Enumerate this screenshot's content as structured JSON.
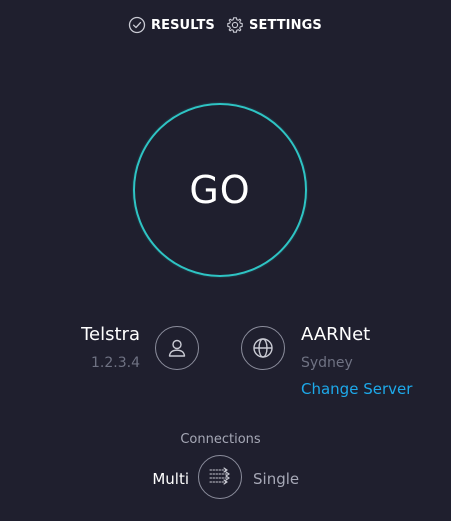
{
  "nav": {
    "results_label": "RESULTS",
    "settings_label": "SETTINGS"
  },
  "go_button": {
    "label": "GO"
  },
  "isp": {
    "name": "Telstra",
    "ip": "1.2.3.4"
  },
  "server": {
    "name": "AARNet",
    "location": "Sydney",
    "change_label": "Change Server"
  },
  "connections": {
    "title": "Connections",
    "multi_label": "Multi",
    "single_label": "Single",
    "selected": "Multi"
  },
  "colors": {
    "background": "#1f1f2e",
    "go_ring": "#2ec4c4",
    "link": "#1da9ea",
    "muted_text": "#6f7283",
    "icon_stroke": "#8b8d9c"
  },
  "icons": {
    "results": "check-circle-icon",
    "settings": "gear-icon",
    "isp": "user-icon",
    "server": "globe-icon",
    "connections": "connections-arrows-icon"
  }
}
